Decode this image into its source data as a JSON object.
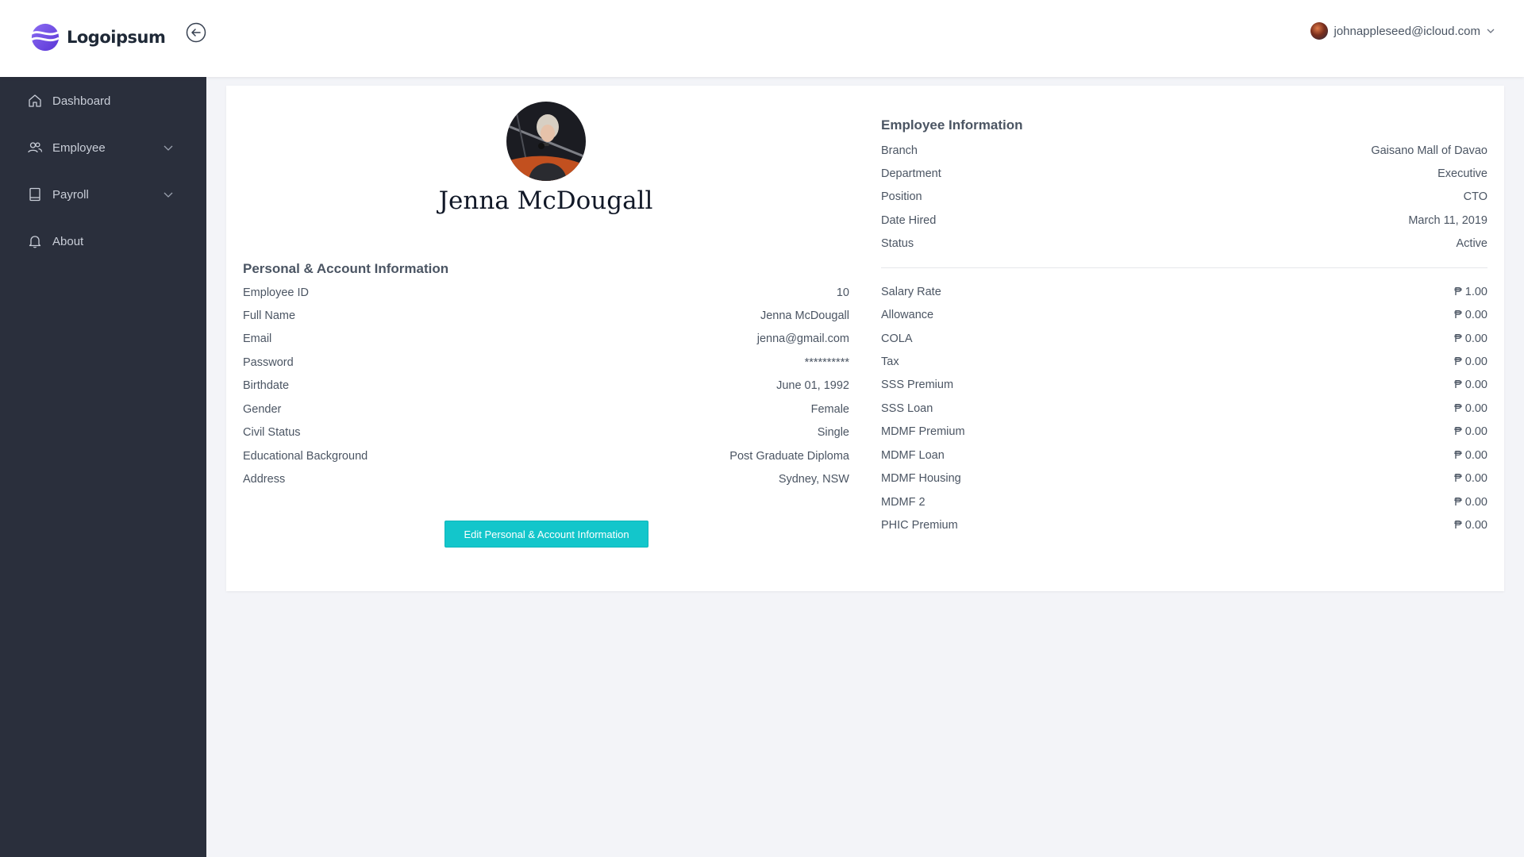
{
  "header": {
    "logo_text": "Logoipsum",
    "user_email": "johnappleseed@icloud.com"
  },
  "sidebar": {
    "items": [
      {
        "label": "Dashboard",
        "icon": "home-icon",
        "has_submenu": false
      },
      {
        "label": "Employee",
        "icon": "users-icon",
        "has_submenu": true
      },
      {
        "label": "Payroll",
        "icon": "book-icon",
        "has_submenu": true
      },
      {
        "label": "About",
        "icon": "bell-icon",
        "has_submenu": false
      }
    ]
  },
  "profile": {
    "name": "Jenna McDougall"
  },
  "personal": {
    "title": "Personal & Account Information",
    "rows": [
      {
        "label": "Employee ID",
        "value": "10"
      },
      {
        "label": "Full Name",
        "value": "Jenna McDougall"
      },
      {
        "label": "Email",
        "value": "jenna@gmail.com"
      },
      {
        "label": "Password",
        "value": "**********"
      },
      {
        "label": "Birthdate",
        "value": "June 01, 1992"
      },
      {
        "label": "Gender",
        "value": "Female"
      },
      {
        "label": "Civil Status",
        "value": "Single"
      },
      {
        "label": "Educational Background",
        "value": "Post Graduate Diploma"
      },
      {
        "label": "Address",
        "value": "Sydney, NSW"
      }
    ],
    "edit_button": "Edit Personal & Account Information"
  },
  "employee": {
    "title": "Employee Information",
    "rows": [
      {
        "label": "Branch",
        "value": "Gaisano Mall of Davao"
      },
      {
        "label": "Department",
        "value": "Executive"
      },
      {
        "label": "Position",
        "value": "CTO"
      },
      {
        "label": "Date Hired",
        "value": "March 11, 2019"
      },
      {
        "label": "Status",
        "value": "Active"
      }
    ]
  },
  "salary": {
    "rows": [
      {
        "label": "Salary Rate",
        "value": "₱ 1.00"
      },
      {
        "label": "Allowance",
        "value": "₱ 0.00"
      },
      {
        "label": "COLA",
        "value": "₱ 0.00"
      },
      {
        "label": "Tax",
        "value": "₱ 0.00"
      },
      {
        "label": "SSS Premium",
        "value": "₱ 0.00"
      },
      {
        "label": "SSS Loan",
        "value": "₱ 0.00"
      },
      {
        "label": "MDMF Premium",
        "value": "₱ 0.00"
      },
      {
        "label": "MDMF Loan",
        "value": "₱ 0.00"
      },
      {
        "label": "MDMF Housing",
        "value": "₱ 0.00"
      },
      {
        "label": "MDMF 2",
        "value": "₱ 0.00"
      },
      {
        "label": "PHIC Premium",
        "value": "₱ 0.00"
      }
    ]
  },
  "colors": {
    "sidebar_bg": "#2a2f3c",
    "accent_button": "#13c6cb",
    "logo_purple": "#6d4ae0"
  }
}
